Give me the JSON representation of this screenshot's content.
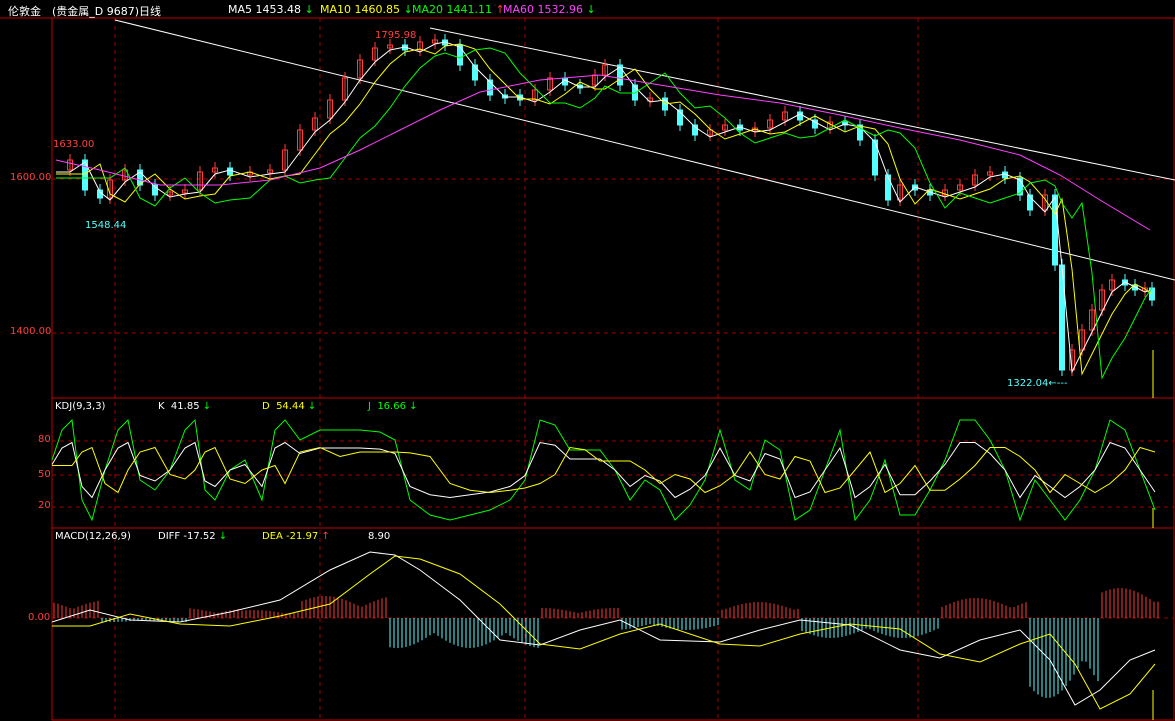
{
  "header": {
    "title": "伦敦金",
    "instrument": "(贵金属_D  9687)日线",
    "ma5": {
      "label": "MA5",
      "value": "1453.48",
      "arrow": "↓",
      "color": "#ffffff"
    },
    "ma10": {
      "label": "MA10",
      "value": "1460.85",
      "arrow": "↓",
      "color": "#ffff00"
    },
    "ma20": {
      "label": "MA20",
      "value": "1441.11",
      "arrow": "↑",
      "color": "#00ff00"
    },
    "ma60": {
      "label": "MA60",
      "value": "1532.96",
      "arrow": "↓",
      "color": "#ff40ff"
    }
  },
  "price_panel": {
    "y_ticks": [
      "1600.00",
      "1400.00"
    ],
    "annotations": {
      "high": "1795.98",
      "left_high": "1633.00",
      "left_low": "1548.44",
      "low": "1322.04←---"
    }
  },
  "kdj_panel": {
    "title": "KDJ(9,3,3)",
    "k": {
      "label": "K",
      "value": "41.85",
      "arrow": "↓"
    },
    "d": {
      "label": "D",
      "value": "54.44",
      "arrow": "↓"
    },
    "j": {
      "label": "J",
      "value": "16.66",
      "arrow": "↓"
    },
    "y_ticks": [
      "80",
      "50",
      "20"
    ]
  },
  "macd_panel": {
    "title": "MACD(12,26,9)",
    "diff": {
      "label": "DIFF",
      "value": "-17.52",
      "arrow": "↓"
    },
    "dea": {
      "label": "DEA",
      "value": "-21.97",
      "arrow": "↑"
    },
    "macd_value": "8.90",
    "y_ticks": [
      "0.00"
    ]
  },
  "colors": {
    "up_candle": "#ff3c3c",
    "down_candle": "#54ffff",
    "grid": "#a00000",
    "axis": "#c00000",
    "channel": "#ffffff"
  }
}
